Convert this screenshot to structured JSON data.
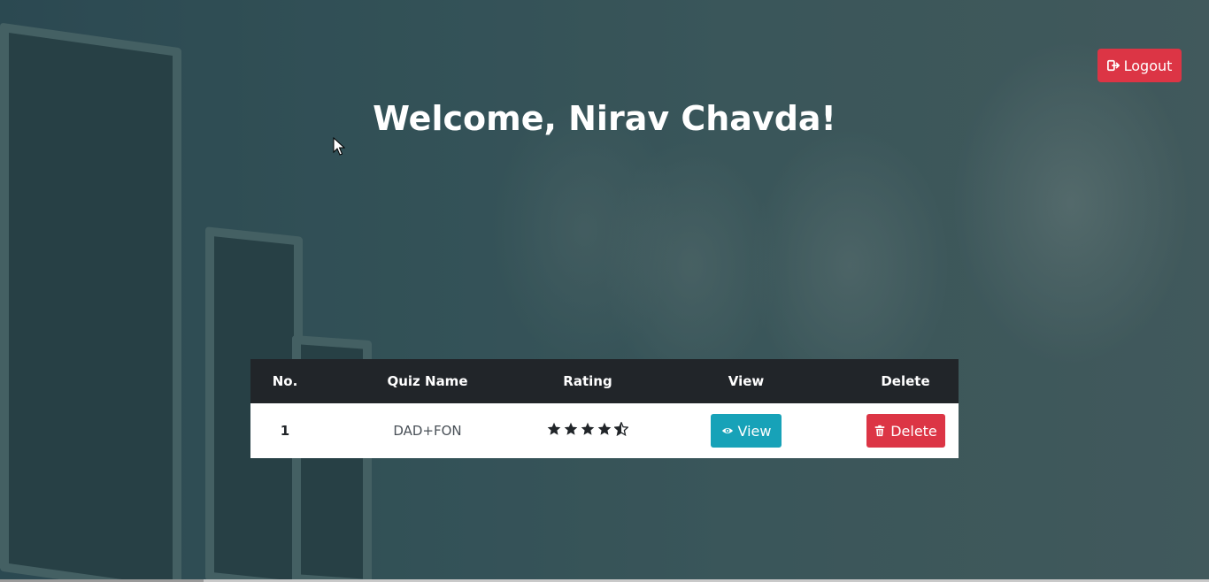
{
  "header": {
    "welcome_text": "Welcome, Nirav Chavda!",
    "logout_label": "Logout"
  },
  "table": {
    "headers": [
      "No.",
      "Quiz Name",
      "Rating",
      "View",
      "Delete"
    ],
    "rows": [
      {
        "no": "1",
        "quiz_name": "DAD+FON",
        "rating": 4.5,
        "view_label": "View",
        "delete_label": "Delete"
      }
    ]
  },
  "colors": {
    "danger": "#dc3545",
    "info": "#17a2b8",
    "table_header": "#212529"
  },
  "icons": {
    "logout": "sign-out-icon",
    "view": "eye-icon",
    "delete": "trash-icon",
    "rating": "star-icon"
  }
}
